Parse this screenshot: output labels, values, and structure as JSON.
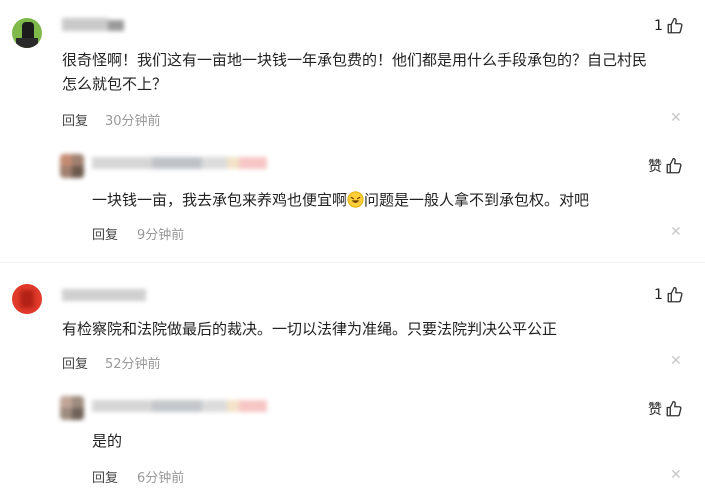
{
  "comments": [
    {
      "content_line1": "很奇怪啊！我们这有一亩地一块钱一年承包费的！他们都是用什么手段承包的？自己村民",
      "content_line2": "怎么就包不上？",
      "reply_label": "回复",
      "time": "30分钟前",
      "like_count": "1",
      "reply": {
        "content_before_emoji": "一块钱一亩，我去承包来养鸡也便宜啊",
        "emoji": "laughing-emoji",
        "content_after_emoji": "问题是一般人拿不到承包权。对吧",
        "reply_label": "回复",
        "time": "9分钟前",
        "like_label": "赞"
      }
    },
    {
      "content_line1": "有检察院和法院做最后的裁决。一切以法律为准绳。只要法院判决公平公正",
      "reply_label": "回复",
      "time": "52分钟前",
      "like_count": "1",
      "reply": {
        "content": "是的",
        "reply_label": "回复",
        "time": "6分钟前",
        "like_label": "赞"
      }
    }
  ],
  "icons": {
    "like": "thumbs-up-icon",
    "close": "close-icon"
  },
  "colors": {
    "time": "#999999",
    "close": "#c8c8c8",
    "text": "#222222"
  }
}
